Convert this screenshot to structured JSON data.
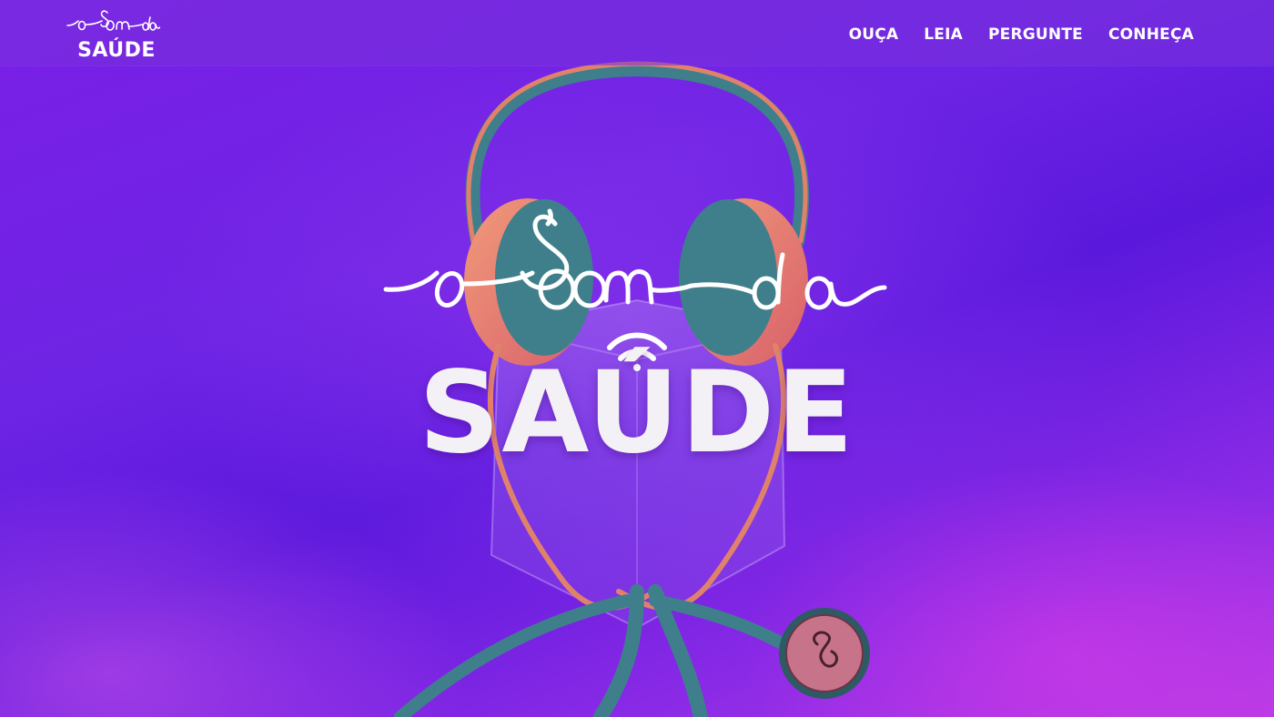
{
  "brand": {
    "script": "o Som da",
    "word": "SAÚDE"
  },
  "nav": {
    "items": [
      "OUÇA",
      "LEIA",
      "PERGUNTE",
      "CONHEÇA"
    ]
  },
  "hero": {
    "script": "o Som da",
    "word": "SAÚDE",
    "chestpiece_text": "O SOM DA SAÚDE"
  },
  "colors": {
    "accent": "#ffffff",
    "background": "#6a1fe0",
    "tube": "#3f7f8c",
    "headphone_band": "#e0826a"
  },
  "icons": [
    "wifi-icon",
    "headphones-illustration",
    "stethoscope-illustration"
  ]
}
